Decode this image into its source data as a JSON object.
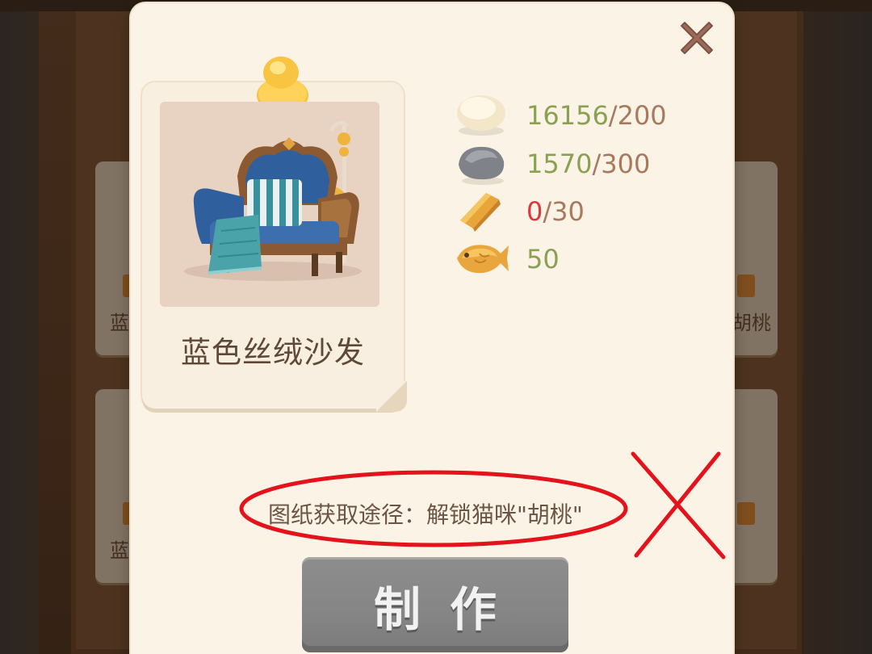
{
  "background": {
    "left_cards": [
      {
        "label": "蓝"
      },
      {
        "label": "蓝"
      }
    ],
    "right_cards": [
      {
        "label": "胡桃"
      },
      {
        "label": ""
      }
    ]
  },
  "modal": {
    "item": {
      "name": "蓝色丝绒沙发",
      "image_icon": "blue-velvet-sofa-icon"
    },
    "materials": [
      {
        "icon": "cotton-ball-icon",
        "have": "16156",
        "sep": "/",
        "need": "200",
        "sufficient": true
      },
      {
        "icon": "stone-icon",
        "have": "1570",
        "sep": "/",
        "need": "300",
        "sufficient": true
      },
      {
        "icon": "wood-plank-icon",
        "have": "0",
        "sep": "/",
        "need": "30",
        "sufficient": false
      },
      {
        "icon": "taiyaki-fish-icon",
        "value": "50"
      }
    ],
    "source_text": "图纸获取途径：解锁猫咪\"胡桃\"",
    "craft_button": {
      "label": "制作",
      "enabled": false
    },
    "close_icon": "close-icon"
  },
  "colors": {
    "sufficient": "#8aa053",
    "insufficient": "#e0383a",
    "annotation": "#e3121b",
    "button_disabled": "#858585"
  }
}
